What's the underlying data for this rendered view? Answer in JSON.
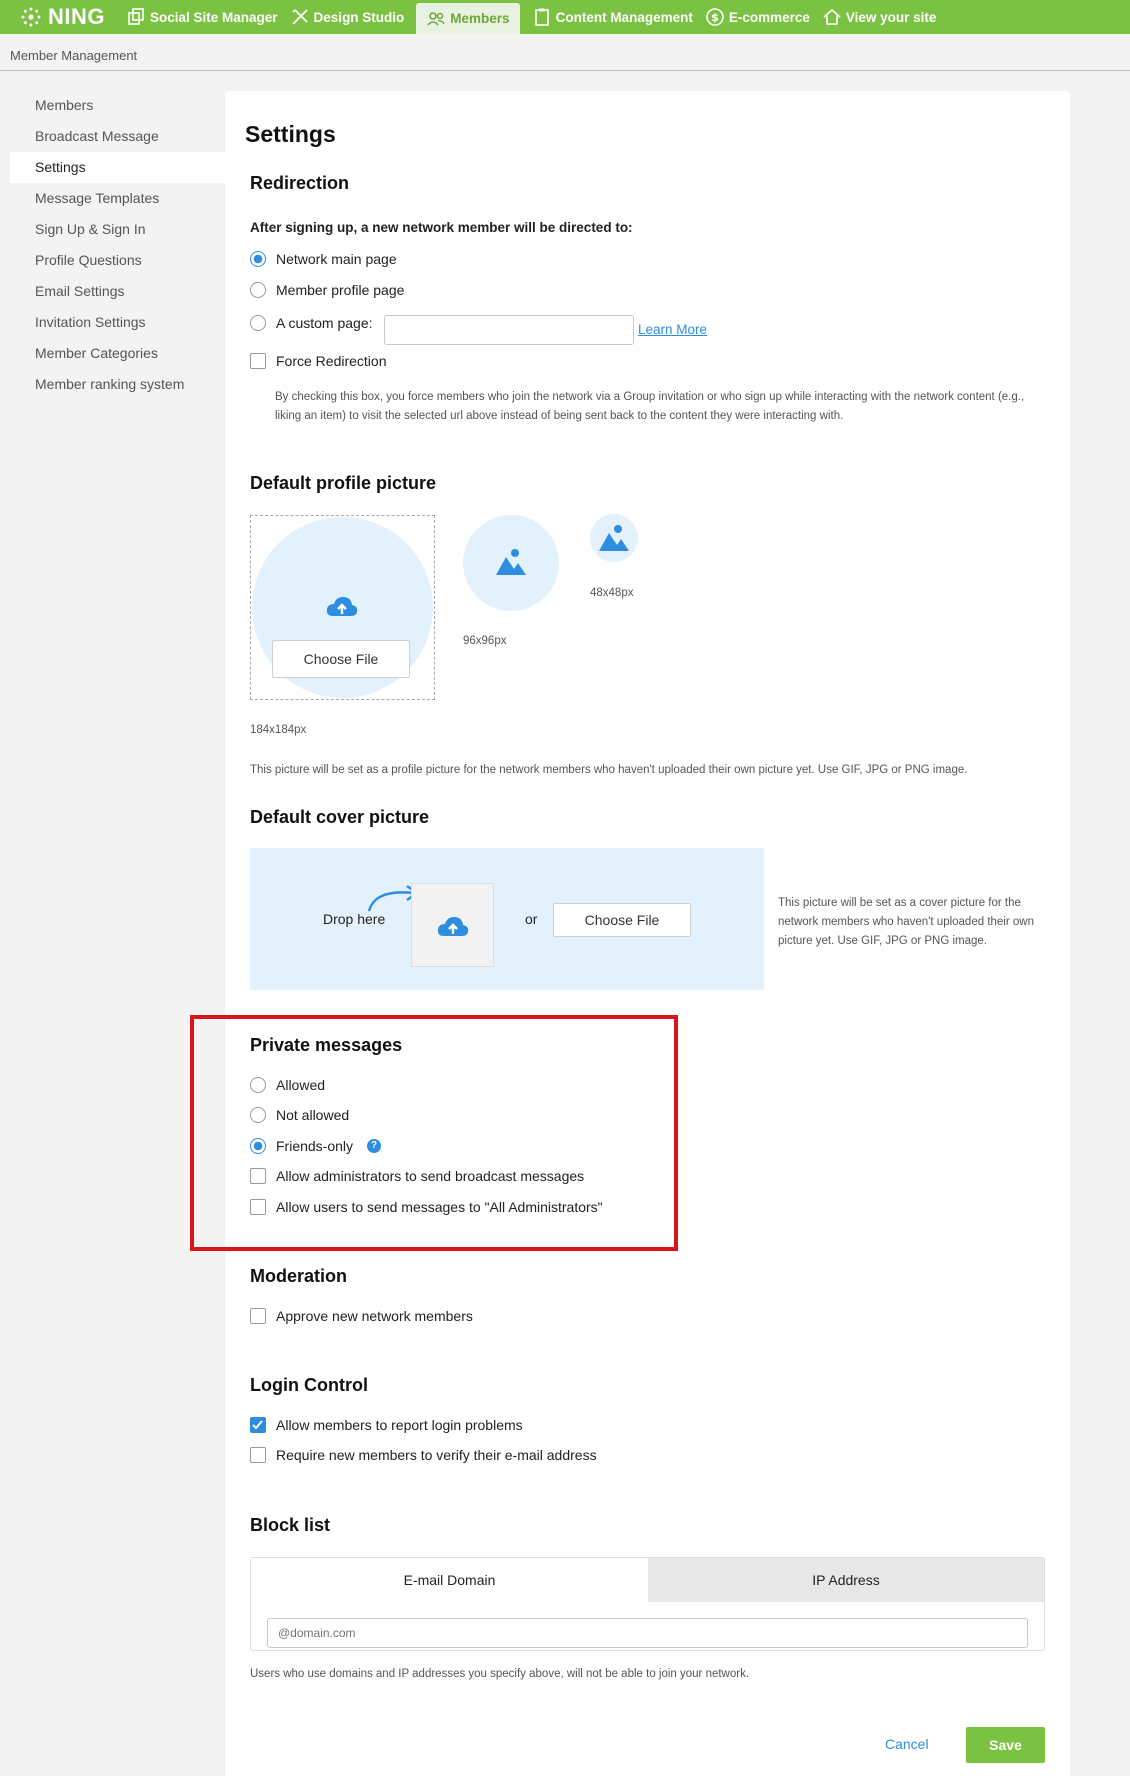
{
  "nav": {
    "logo": "NING",
    "items": [
      {
        "label": "Social Site Manager",
        "icon": "copy-icon"
      },
      {
        "label": "Design Studio",
        "icon": "tools-icon"
      },
      {
        "label": "Members",
        "icon": "users-icon",
        "active": true
      },
      {
        "label": "Content Management",
        "icon": "clipboard-icon"
      },
      {
        "label": "E-commerce",
        "icon": "dollar-icon"
      },
      {
        "label": "View your site",
        "icon": "home-icon"
      }
    ]
  },
  "breadcrumb": "Member Management",
  "sidebar": {
    "items": [
      "Members",
      "Broadcast Message",
      "Settings",
      "Message Templates",
      "Sign Up & Sign In",
      "Profile Questions",
      "Email Settings",
      "Invitation Settings",
      "Member Categories",
      "Member ranking system"
    ],
    "active_index": 2
  },
  "settings": {
    "title": "Settings",
    "redirection": {
      "heading": "Redirection",
      "question": "After signing up, a new network member will be directed to:",
      "option_main": "Network main page",
      "option_profile": "Member profile page",
      "option_custom": "A custom page:",
      "custom_value": "",
      "learn_more": "Learn More",
      "force_label": "Force Redirection",
      "force_note": "By checking this box, you force members who join the network via a Group invitation or who sign up while interacting with the network content (e.g., liking an item) to visit the selected url above instead of being sent back to the content they were interacting with."
    },
    "profile_picture": {
      "heading": "Default profile picture",
      "choose_file": "Choose File",
      "size_large": "184x184px",
      "size_medium": "96x96px",
      "size_small": "48x48px",
      "note": "This picture will be set as a profile picture for the network members who haven't uploaded their own picture yet. Use GIF, JPG or PNG image."
    },
    "cover_picture": {
      "heading": "Default cover picture",
      "drop_here": "Drop here",
      "or": "or",
      "choose_file": "Choose File",
      "note": "This picture will be set as a cover picture for the network members who haven't uploaded their own picture yet. Use GIF, JPG or PNG image."
    },
    "private_messages": {
      "heading": "Private messages",
      "allowed": "Allowed",
      "not_allowed": "Not allowed",
      "friends_only": "Friends-only",
      "admin_broadcast": "Allow administrators to send broadcast messages",
      "users_to_admins": "Allow users to send messages to \"All Administrators\""
    },
    "moderation": {
      "heading": "Moderation",
      "approve": "Approve new network members"
    },
    "login_control": {
      "heading": "Login Control",
      "report_problems": "Allow members to report login problems",
      "verify_email": "Require new members to verify their e-mail address"
    },
    "block_list": {
      "heading": "Block list",
      "tab_email": "E-mail Domain",
      "tab_ip": "IP Address",
      "placeholder": "@domain.com",
      "note": "Users who use domains and IP addresses you specify above, will not be able to join your network."
    },
    "cancel": "Cancel",
    "save": "Save"
  },
  "colors": {
    "brand_green": "#7cc242",
    "accent_blue": "#2d8ee0",
    "highlight_red": "#d6161a",
    "upload_bg": "#e3f1fd"
  }
}
